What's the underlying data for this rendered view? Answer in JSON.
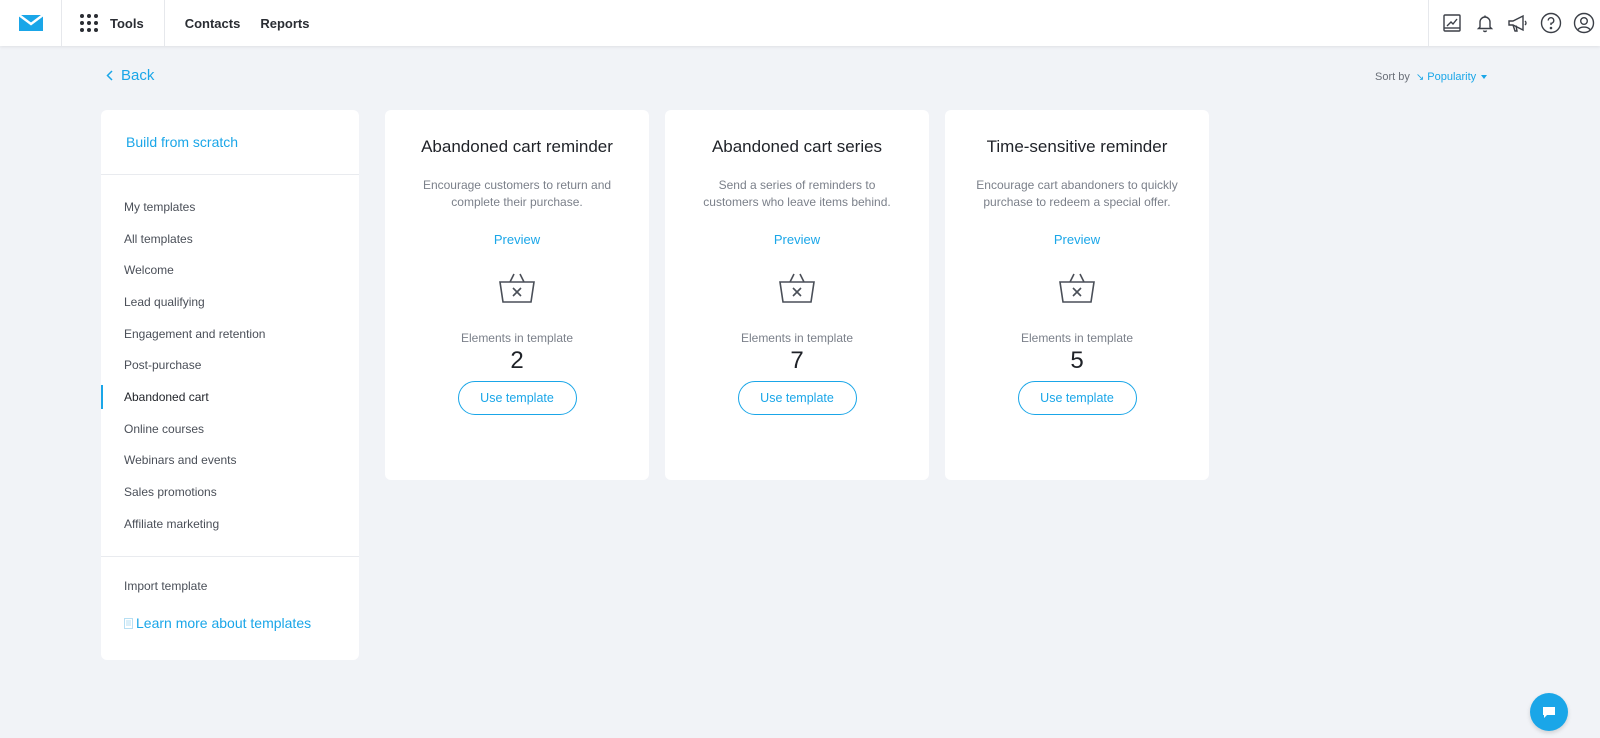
{
  "header": {
    "tools_label": "Tools",
    "nav": [
      "Contacts",
      "Reports"
    ],
    "icons": [
      "website-builder-icon",
      "bell-icon",
      "megaphone-icon",
      "help-icon",
      "user-icon"
    ]
  },
  "back_label": "Back",
  "sort": {
    "label": "Sort by",
    "value": "Popularity"
  },
  "sidebar": {
    "build_from_scratch": "Build from scratch",
    "categories": [
      "My templates",
      "All templates",
      "Welcome",
      "Lead qualifying",
      "Engagement and retention",
      "Post-purchase",
      "Abandoned cart",
      "Online courses",
      "Webinars and events",
      "Sales promotions",
      "Affiliate marketing"
    ],
    "active_category": "Abandoned cart",
    "import_template": "Import template",
    "learn_more": "Learn more about templates"
  },
  "cards": [
    {
      "title": "Abandoned cart reminder",
      "description": "Encourage customers to return and complete their purchase.",
      "preview": "Preview",
      "elements_label": "Elements in template",
      "elements_count": "2",
      "button": "Use template"
    },
    {
      "title": "Abandoned cart series",
      "description": "Send a series of reminders to customers who leave items behind.",
      "preview": "Preview",
      "elements_label": "Elements in template",
      "elements_count": "7",
      "button": "Use template"
    },
    {
      "title": "Time-sensitive reminder",
      "description": "Encourage cart abandoners to quickly purchase to redeem a special offer.",
      "preview": "Preview",
      "elements_label": "Elements in template",
      "elements_count": "5",
      "button": "Use template"
    }
  ],
  "colors": {
    "accent": "#1aa6e8",
    "background": "#f1f3f7",
    "text": "#1f2228"
  }
}
